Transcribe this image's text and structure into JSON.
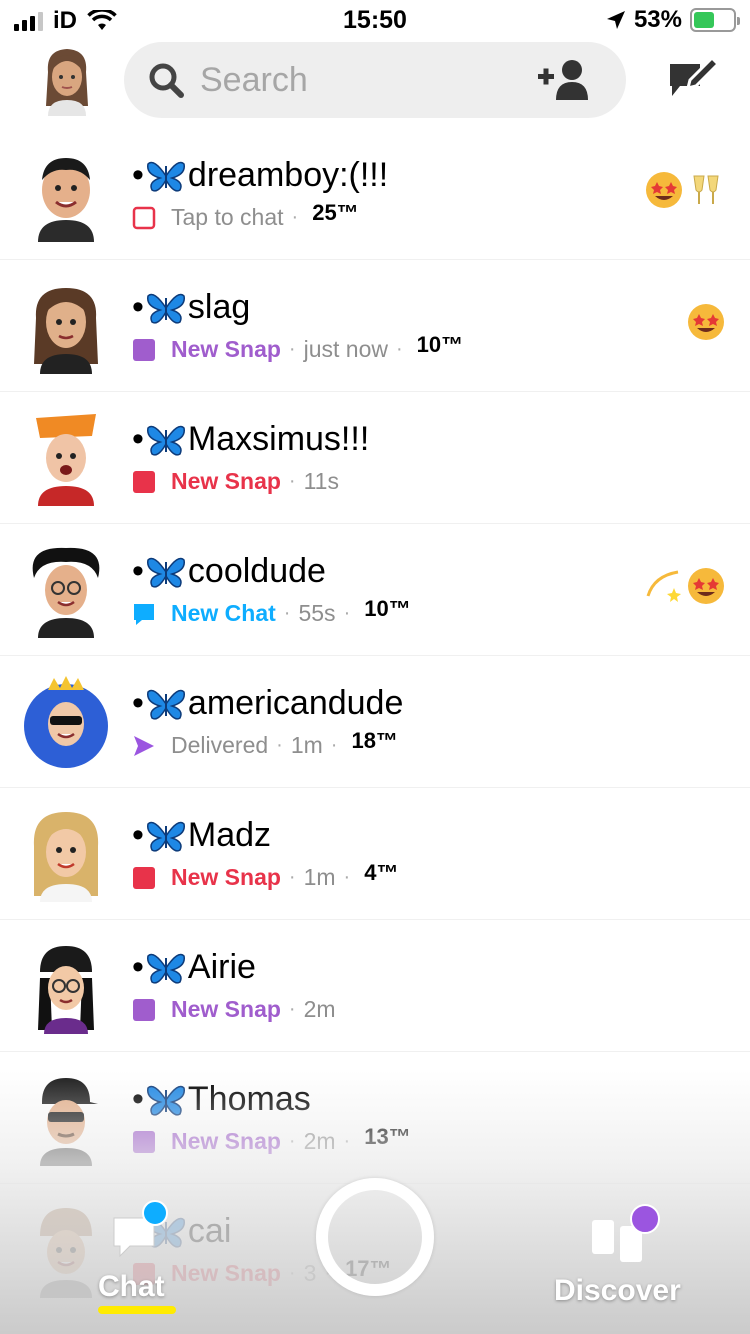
{
  "status_bar": {
    "carrier": "iD",
    "time": "15:50",
    "battery": "53%",
    "battery_level": 0.53
  },
  "header": {
    "search_placeholder": "Search"
  },
  "chats": [
    {
      "name": "dreamboy:(!!!",
      "status": "Tap to chat",
      "status_type": "tap",
      "time": "",
      "streak": "25™",
      "emojis": "🤩🥂"
    },
    {
      "name": "slag",
      "status": "New Snap",
      "status_type": "snap-purple",
      "time": "just now",
      "streak": "10™",
      "emojis": "🤩"
    },
    {
      "name": "Maxsimus!!!",
      "status": "New Snap",
      "status_type": "snap-red",
      "time": "11s",
      "streak": "",
      "emojis": ""
    },
    {
      "name": "cooldude",
      "status": "New Chat",
      "status_type": "chat-blue",
      "time": "55s",
      "streak": "10™",
      "emojis": "💫🤩"
    },
    {
      "name": "americandude",
      "status": "Delivered",
      "status_type": "delivered",
      "time": "1m",
      "streak": "18™",
      "emojis": ""
    },
    {
      "name": "Madz",
      "status": "New Snap",
      "status_type": "snap-red",
      "time": "1m",
      "streak": "4™",
      "emojis": ""
    },
    {
      "name": "Airie",
      "status": "New Snap",
      "status_type": "snap-purple",
      "time": "2m",
      "streak": "",
      "emojis": ""
    },
    {
      "name": "Thomas",
      "status": "New Snap",
      "status_type": "snap-purple",
      "time": "2m",
      "streak": "13™",
      "emojis": ""
    },
    {
      "name": "cai",
      "status": "New Snap",
      "status_type": "snap-red",
      "time": "3",
      "streak": "17™",
      "emojis": ""
    }
  ],
  "nav": {
    "chat_label": "Chat",
    "discover_label": "Discover"
  },
  "colors": {
    "snap_purple": "#a05dcd",
    "snap_red": "#e8334a",
    "chat_blue": "#0eadff",
    "delivered_purple": "#9b55e0",
    "streak_underline": "#ffeb00",
    "butterfly_blue": "#1e88e5"
  },
  "icons": {
    "butterfly": "butterfly-icon",
    "search": "search-icon",
    "add_friend": "add-friend-icon",
    "new_chat": "new-chat-icon",
    "discover": "discover-icon"
  }
}
